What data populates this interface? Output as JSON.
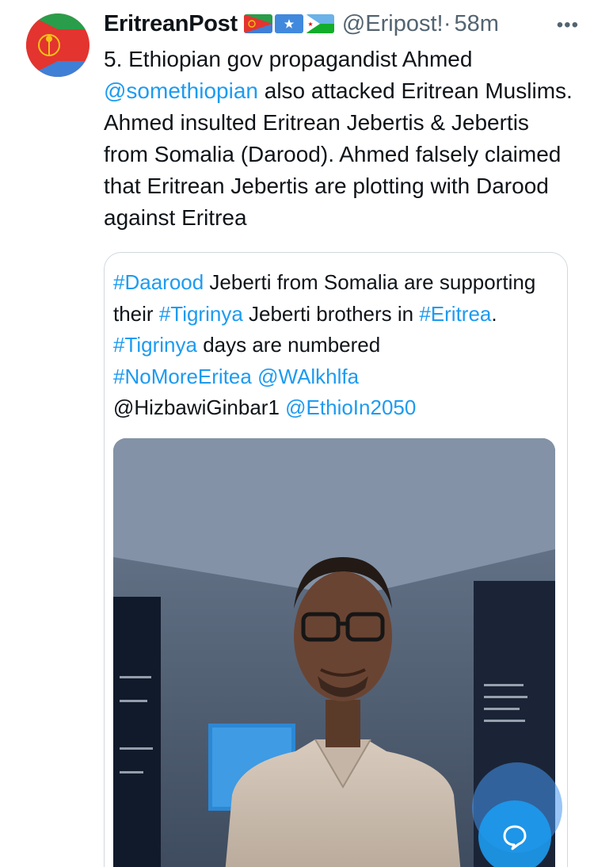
{
  "author": {
    "display_name": "EritreanPost",
    "handle": "@Eripost!",
    "separator": "·",
    "time_ago": "58m",
    "more_glyph": "•••"
  },
  "icons": {
    "avatar": "eritrea-emblem-avatar",
    "flags": [
      "eritrea-flag",
      "somalia-flag",
      "djibouti-flag"
    ],
    "more": "more-icon",
    "fab": "compose-message-icon"
  },
  "tweet": {
    "segments": [
      "5. Ethiopian gov propagandist Ahmed ",
      "@somethiopian",
      " also attacked Eritrean Muslims. Ahmed insulted Eritrean Jebertis & Jebertis from Somalia (Darood). Ahmed falsely claimed that Eritrean Jebertis are plotting with Darood against Eritrea"
    ]
  },
  "quote": {
    "segments": [
      "#Daarood",
      " Jeberti from Somalia are supporting their ",
      "#Tigrinya",
      " Jeberti brothers in ",
      "#Eritrea",
      ". ",
      "#Tigrinya",
      " days are numbered ",
      "#NoMoreEritea",
      " ",
      "@WAlkhlfa",
      "@HizbawiGinbar1",
      " ",
      "@EthioIn2050"
    ]
  },
  "colors": {
    "link": "#1d9bf0",
    "secondary_text": "#536471",
    "border": "#cfd9de"
  }
}
